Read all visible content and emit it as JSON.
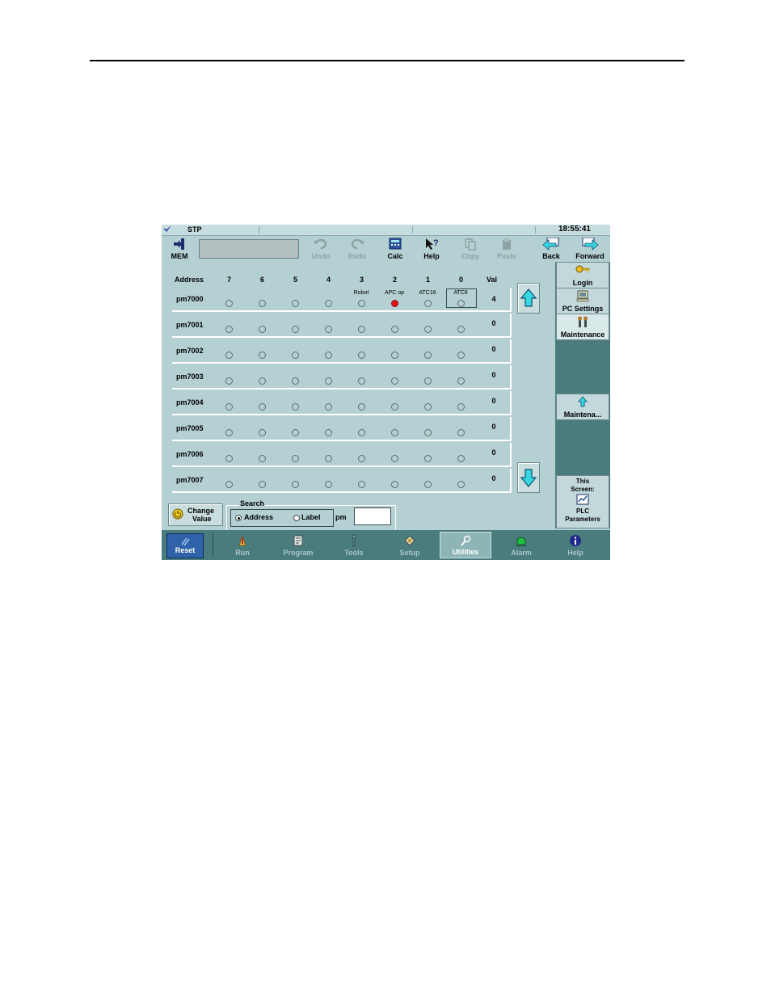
{
  "statusbar": {
    "mode": "STP",
    "time": "18:55:41"
  },
  "toolbar": {
    "mem": "MEM",
    "undo": "Undo",
    "redo": "Redo",
    "calc": "Calc",
    "help": "Help",
    "copy": "Copy",
    "paste": "Paste",
    "back": "Back",
    "forward": "Forward"
  },
  "grid": {
    "headers": {
      "address": "Address",
      "b7": "7",
      "b6": "6",
      "b5": "5",
      "b4": "4",
      "b3": "3",
      "b2": "2",
      "b1": "1",
      "b0": "0",
      "val": "Val"
    },
    "bit_labels": {
      "b3": "Robot",
      "b2": "APC op",
      "b1": "ATC16",
      "b0": "ATC8"
    },
    "rows": [
      {
        "address": "pm7000",
        "value": "4"
      },
      {
        "address": "pm7001",
        "value": "0"
      },
      {
        "address": "pm7002",
        "value": "0"
      },
      {
        "address": "pm7003",
        "value": "0"
      },
      {
        "address": "pm7004",
        "value": "0"
      },
      {
        "address": "pm7005",
        "value": "0"
      },
      {
        "address": "pm7006",
        "value": "0"
      },
      {
        "address": "pm7007",
        "value": "0"
      }
    ]
  },
  "right_panel": {
    "login": "Login",
    "pc_settings": "PC Settings",
    "maintenance": "Maintenance",
    "maintena": "Maintena...",
    "this_screen_line1": "This",
    "this_screen_line2": "Screen:",
    "this_screen_line3": "PLC",
    "this_screen_line4": "Parameters"
  },
  "bottom": {
    "change_line1": "Change",
    "change_line2": "Value",
    "search_legend": "Search",
    "address_option": "Address",
    "label_option": "Label",
    "prefix": "pm",
    "search_value": ""
  },
  "nav": {
    "reset": "Reset",
    "run": "Run",
    "program": "Program",
    "tools": "Tools",
    "setup": "Setup",
    "utilities": "Utilities",
    "alarm": "Alarm",
    "help": "Help"
  },
  "colors": {
    "screen_bg": "#b4d0d3",
    "panel_dark": "#4a7c7d",
    "bit_on": "#e0141b",
    "reset_blue": "#2f62a8",
    "arrow_cyan": "#36d8e0"
  }
}
